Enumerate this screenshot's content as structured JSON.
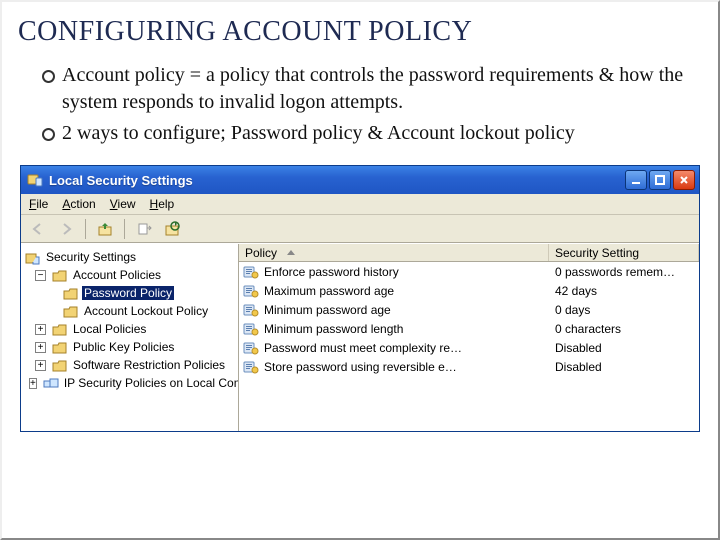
{
  "slide": {
    "title": "CONFIGURING ACCOUNT POLICY",
    "bullets": [
      "Account policy = a policy that controls the password requirements & how the system responds to invalid logon attempts.",
      "2 ways to configure; Password policy & Account lockout policy"
    ]
  },
  "window": {
    "title": "Local Security Settings",
    "menus": [
      "File",
      "Action",
      "View",
      "Help"
    ],
    "tree": {
      "root": "Security Settings",
      "items": [
        {
          "label": "Account Policies",
          "expander": "−",
          "indent": 1
        },
        {
          "label": "Password Policy",
          "expander": "",
          "indent": 2,
          "selected": true
        },
        {
          "label": "Account Lockout Policy",
          "expander": "",
          "indent": 2
        },
        {
          "label": "Local Policies",
          "expander": "+",
          "indent": 1
        },
        {
          "label": "Public Key Policies",
          "expander": "+",
          "indent": 1
        },
        {
          "label": "Software Restriction Policies",
          "expander": "+",
          "indent": 1
        },
        {
          "label": "IP Security Policies on Local Computer",
          "expander": "+",
          "indent": 1
        }
      ]
    },
    "columns": {
      "policy": "Policy",
      "setting": "Security Setting"
    },
    "policies": [
      {
        "name": "Enforce password history",
        "value": "0 passwords remem…"
      },
      {
        "name": "Maximum password age",
        "value": "42 days"
      },
      {
        "name": "Minimum password age",
        "value": "0 days"
      },
      {
        "name": "Minimum password length",
        "value": "0 characters"
      },
      {
        "name": "Password must meet complexity re…",
        "value": "Disabled"
      },
      {
        "name": "Store password using reversible e…",
        "value": "Disabled"
      }
    ]
  }
}
